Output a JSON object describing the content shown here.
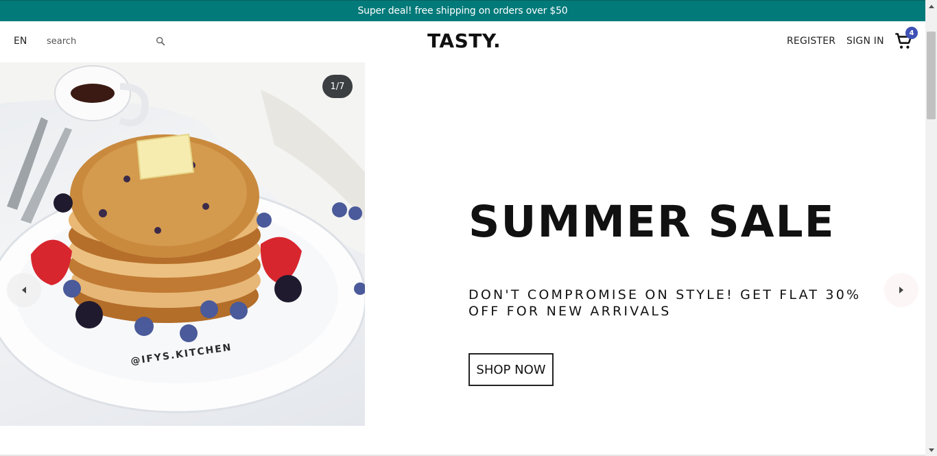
{
  "announcement": {
    "text": "Super deal! free shipping on orders over $50",
    "background": "#037a7a"
  },
  "header": {
    "language": "EN",
    "search_placeholder": "search",
    "logo": "TASTY.",
    "register_label": "REGISTER",
    "signin_label": "SIGN IN",
    "cart_count": "4",
    "badge_color": "#3f51b5"
  },
  "slider": {
    "counter": "1/7",
    "image_watermark": "@IFYS.KITCHEN",
    "title": "SUMMER SALE",
    "description": "DON'T COMPROMISE ON STYLE! GET FLAT 30% OFF FOR NEW ARRIVALS",
    "button_label": "SHOP NOW"
  },
  "icons": {
    "search": "search-icon",
    "cart": "cart-icon",
    "prev": "caret-left-icon",
    "next": "caret-right-icon"
  }
}
